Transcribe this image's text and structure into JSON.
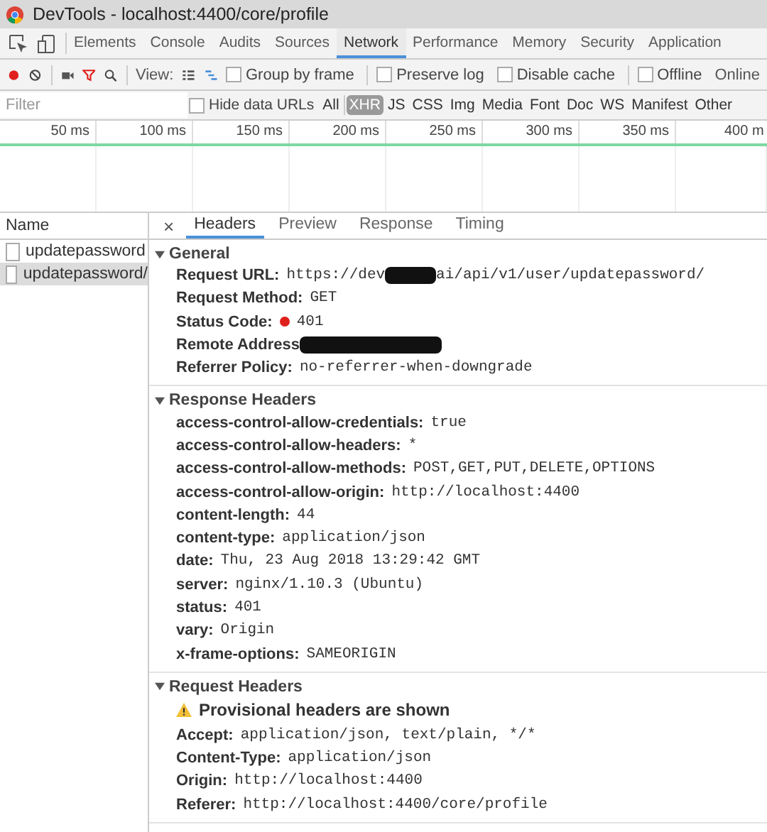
{
  "window": {
    "title": "DevTools - localhost:4400/core/profile"
  },
  "panel_tabs": [
    {
      "label": "Elements",
      "selected": false
    },
    {
      "label": "Console",
      "selected": false
    },
    {
      "label": "Audits",
      "selected": false
    },
    {
      "label": "Sources",
      "selected": false
    },
    {
      "label": "Network",
      "selected": true
    },
    {
      "label": "Performance",
      "selected": false
    },
    {
      "label": "Memory",
      "selected": false
    },
    {
      "label": "Security",
      "selected": false
    },
    {
      "label": "Application",
      "selected": false
    }
  ],
  "toolbar": {
    "recording": true,
    "filter_active": true,
    "view_label": "View:",
    "overview_selected": true,
    "checkboxes": [
      {
        "label": "Group by frame",
        "checked": false
      },
      {
        "label": "Preserve log",
        "checked": false
      },
      {
        "label": "Disable cache",
        "checked": false
      },
      {
        "label": "Offline",
        "checked": false
      }
    ],
    "throttle": "Online"
  },
  "filter": {
    "placeholder": "Filter",
    "hide_data_urls": {
      "label": "Hide data URLs",
      "checked": false
    },
    "types": [
      {
        "label": "All",
        "selected": false
      },
      {
        "label": "XHR",
        "selected": true
      },
      {
        "label": "JS",
        "selected": false
      },
      {
        "label": "CSS",
        "selected": false
      },
      {
        "label": "Img",
        "selected": false
      },
      {
        "label": "Media",
        "selected": false
      },
      {
        "label": "Font",
        "selected": false
      },
      {
        "label": "Doc",
        "selected": false
      },
      {
        "label": "WS",
        "selected": false
      },
      {
        "label": "Manifest",
        "selected": false
      },
      {
        "label": "Other",
        "selected": false
      }
    ]
  },
  "timeline": {
    "ticks": [
      "50 ms",
      "100 ms",
      "150 ms",
      "200 ms",
      "250 ms",
      "300 ms",
      "350 ms",
      "400 m"
    ]
  },
  "requests": {
    "header": "Name",
    "items": [
      {
        "name": "updatepassword",
        "selected": false
      },
      {
        "name": "updatepassword/",
        "selected": true
      }
    ]
  },
  "detail_tabs": {
    "close": "×",
    "tabs": [
      {
        "label": "Headers",
        "selected": true
      },
      {
        "label": "Preview",
        "selected": false
      },
      {
        "label": "Response",
        "selected": false
      },
      {
        "label": "Timing",
        "selected": false
      }
    ]
  },
  "sections": [
    {
      "title": "General",
      "expanded": true,
      "rows": [
        {
          "kind": "redacted",
          "key": "Request URL:",
          "value": "https://dev",
          "value_after": "ai/api/v1/user/updatepassword/"
        },
        {
          "kind": "plain",
          "key": "Request Method:",
          "value": "GET"
        },
        {
          "kind": "status",
          "key": "Status Code:",
          "value": "401"
        },
        {
          "kind": "redacted",
          "key": "Remote Address"
        },
        {
          "kind": "plain",
          "key": "Referrer Policy:",
          "value": "no-referrer-when-downgrade"
        }
      ]
    },
    {
      "title": "Response Headers",
      "expanded": true,
      "rows": [
        {
          "kind": "plain",
          "key": "access-control-allow-credentials:",
          "value": "true"
        },
        {
          "kind": "plain",
          "key": "access-control-allow-headers:",
          "value": "*"
        },
        {
          "kind": "plain",
          "key": "access-control-allow-methods:",
          "value": "POST,GET,PUT,DELETE,OPTIONS"
        },
        {
          "kind": "plain",
          "key": "access-control-allow-origin:",
          "value": "http://localhost:4400"
        },
        {
          "kind": "plain",
          "key": "content-length:",
          "value": "44"
        },
        {
          "kind": "plain",
          "key": "content-type:",
          "value": "application/json"
        },
        {
          "kind": "plain",
          "key": "date:",
          "value": "Thu, 23 Aug 2018 13:29:42 GMT"
        },
        {
          "kind": "plain",
          "key": "server:",
          "value": "nginx/1.10.3 (Ubuntu)"
        },
        {
          "kind": "plain",
          "key": "status:",
          "value": "401"
        },
        {
          "kind": "plain",
          "key": "vary:",
          "value": "Origin"
        },
        {
          "kind": "plain",
          "key": "x-frame-options:",
          "value": "SAMEORIGIN"
        }
      ]
    },
    {
      "title": "Request Headers",
      "expanded": true,
      "rows": [
        {
          "kind": "warning",
          "key": "Provisional headers are shown"
        },
        {
          "kind": "plain",
          "key": "Accept:",
          "value": "application/json, text/plain, */*"
        },
        {
          "kind": "plain",
          "key": "Content-Type:",
          "value": "application/json"
        },
        {
          "kind": "plain",
          "key": "Origin:",
          "value": "http://localhost:4400"
        },
        {
          "kind": "plain",
          "key": "Referer:",
          "value": "http://localhost:4400/core/profile"
        }
      ]
    }
  ]
}
